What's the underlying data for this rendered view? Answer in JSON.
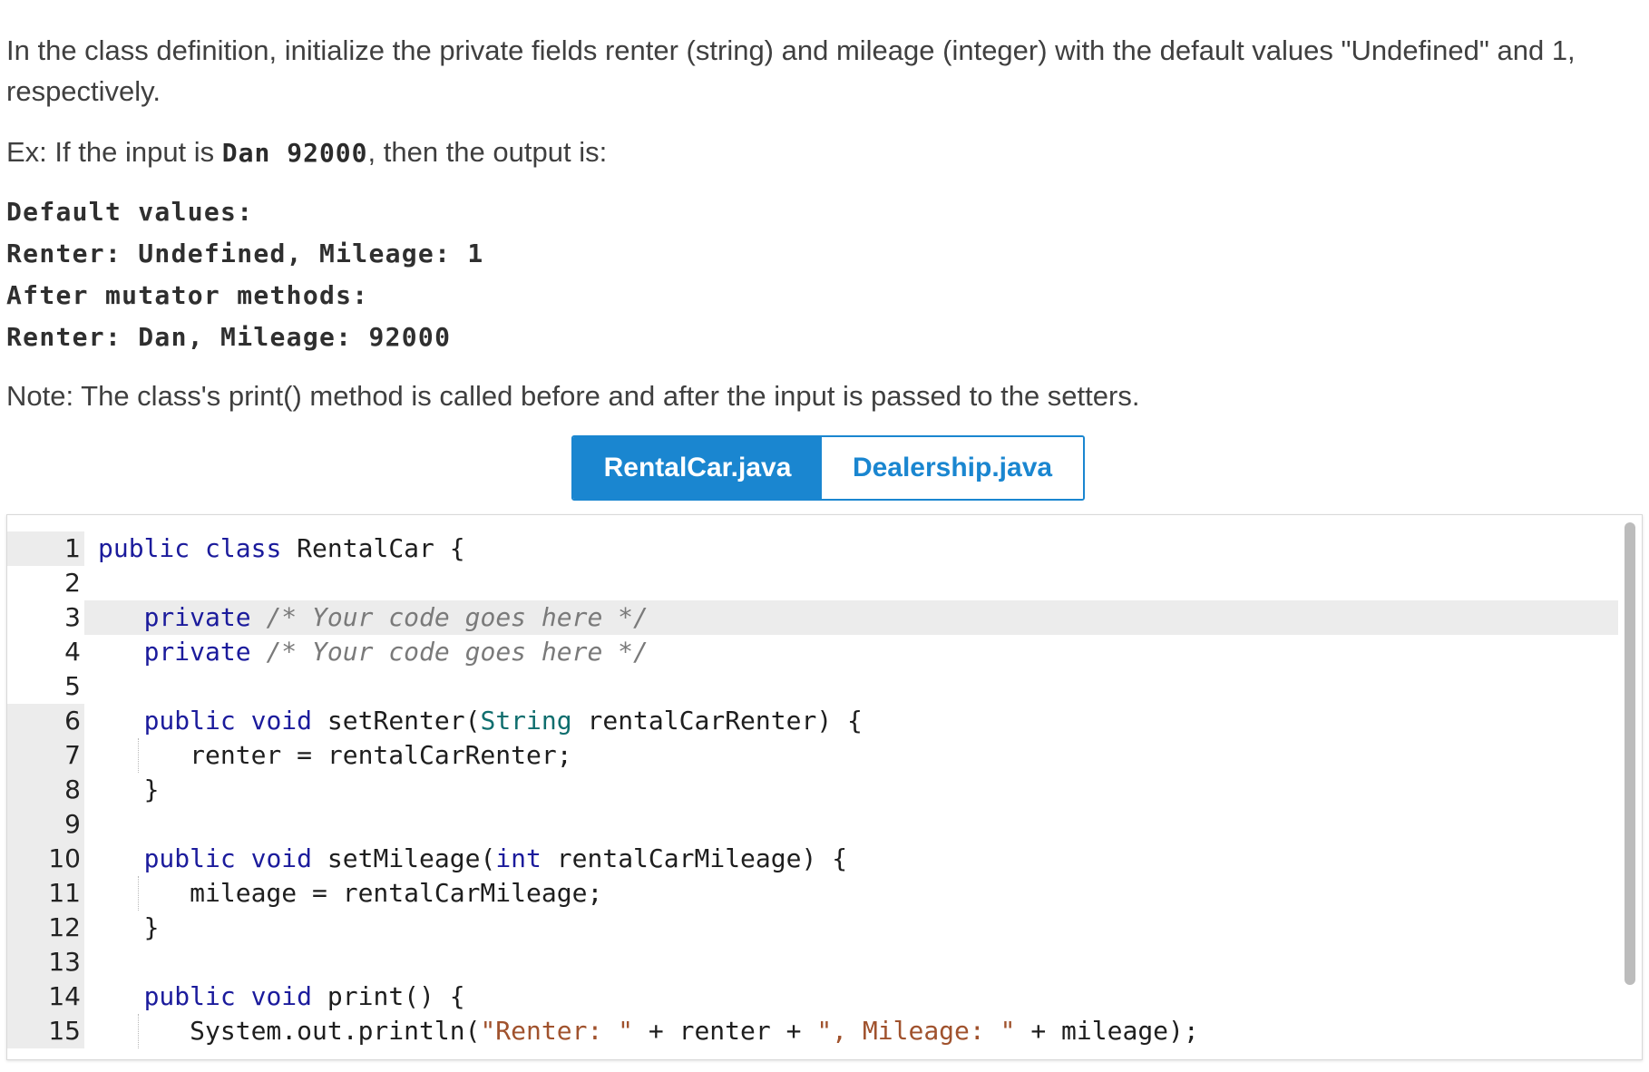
{
  "prompt": {
    "instructions": "In the class definition, initialize the private fields renter (string) and mileage (integer) with the default values \"Undefined\" and 1, respectively.",
    "example_prefix": "Ex: If the input is ",
    "example_input": "Dan 92000",
    "example_suffix": ", then the output is:",
    "output_lines": [
      "Default values:",
      "Renter: Undefined, Mileage: 1",
      "After mutator methods:",
      "Renter: Dan, Mileage: 92000"
    ],
    "note": "Note: The class's print() method is called before and after the input is passed to the setters."
  },
  "tabs": [
    {
      "label": "RentalCar.java",
      "active": true
    },
    {
      "label": "Dealership.java",
      "active": false
    }
  ],
  "editor": {
    "line_numbers": [
      "1",
      "2",
      "3",
      "4",
      "5",
      "6",
      "7",
      "8",
      "9",
      "10",
      "11",
      "12",
      "13",
      "14",
      "15"
    ],
    "lines": [
      "public class RentalCar {",
      "",
      "   private /* Your code goes here */",
      "   private /* Your code goes here */",
      "",
      "   public void setRenter(String rentalCarRenter) {",
      "      renter = rentalCarRenter;",
      "   }",
      "",
      "   public void setMileage(int rentalCarMileage) {",
      "      mileage = rentalCarMileage;",
      "   }",
      "",
      "   public void print() {",
      "      System.out.println(\"Renter: \" + renter + \", Mileage: \" + mileage);"
    ]
  }
}
